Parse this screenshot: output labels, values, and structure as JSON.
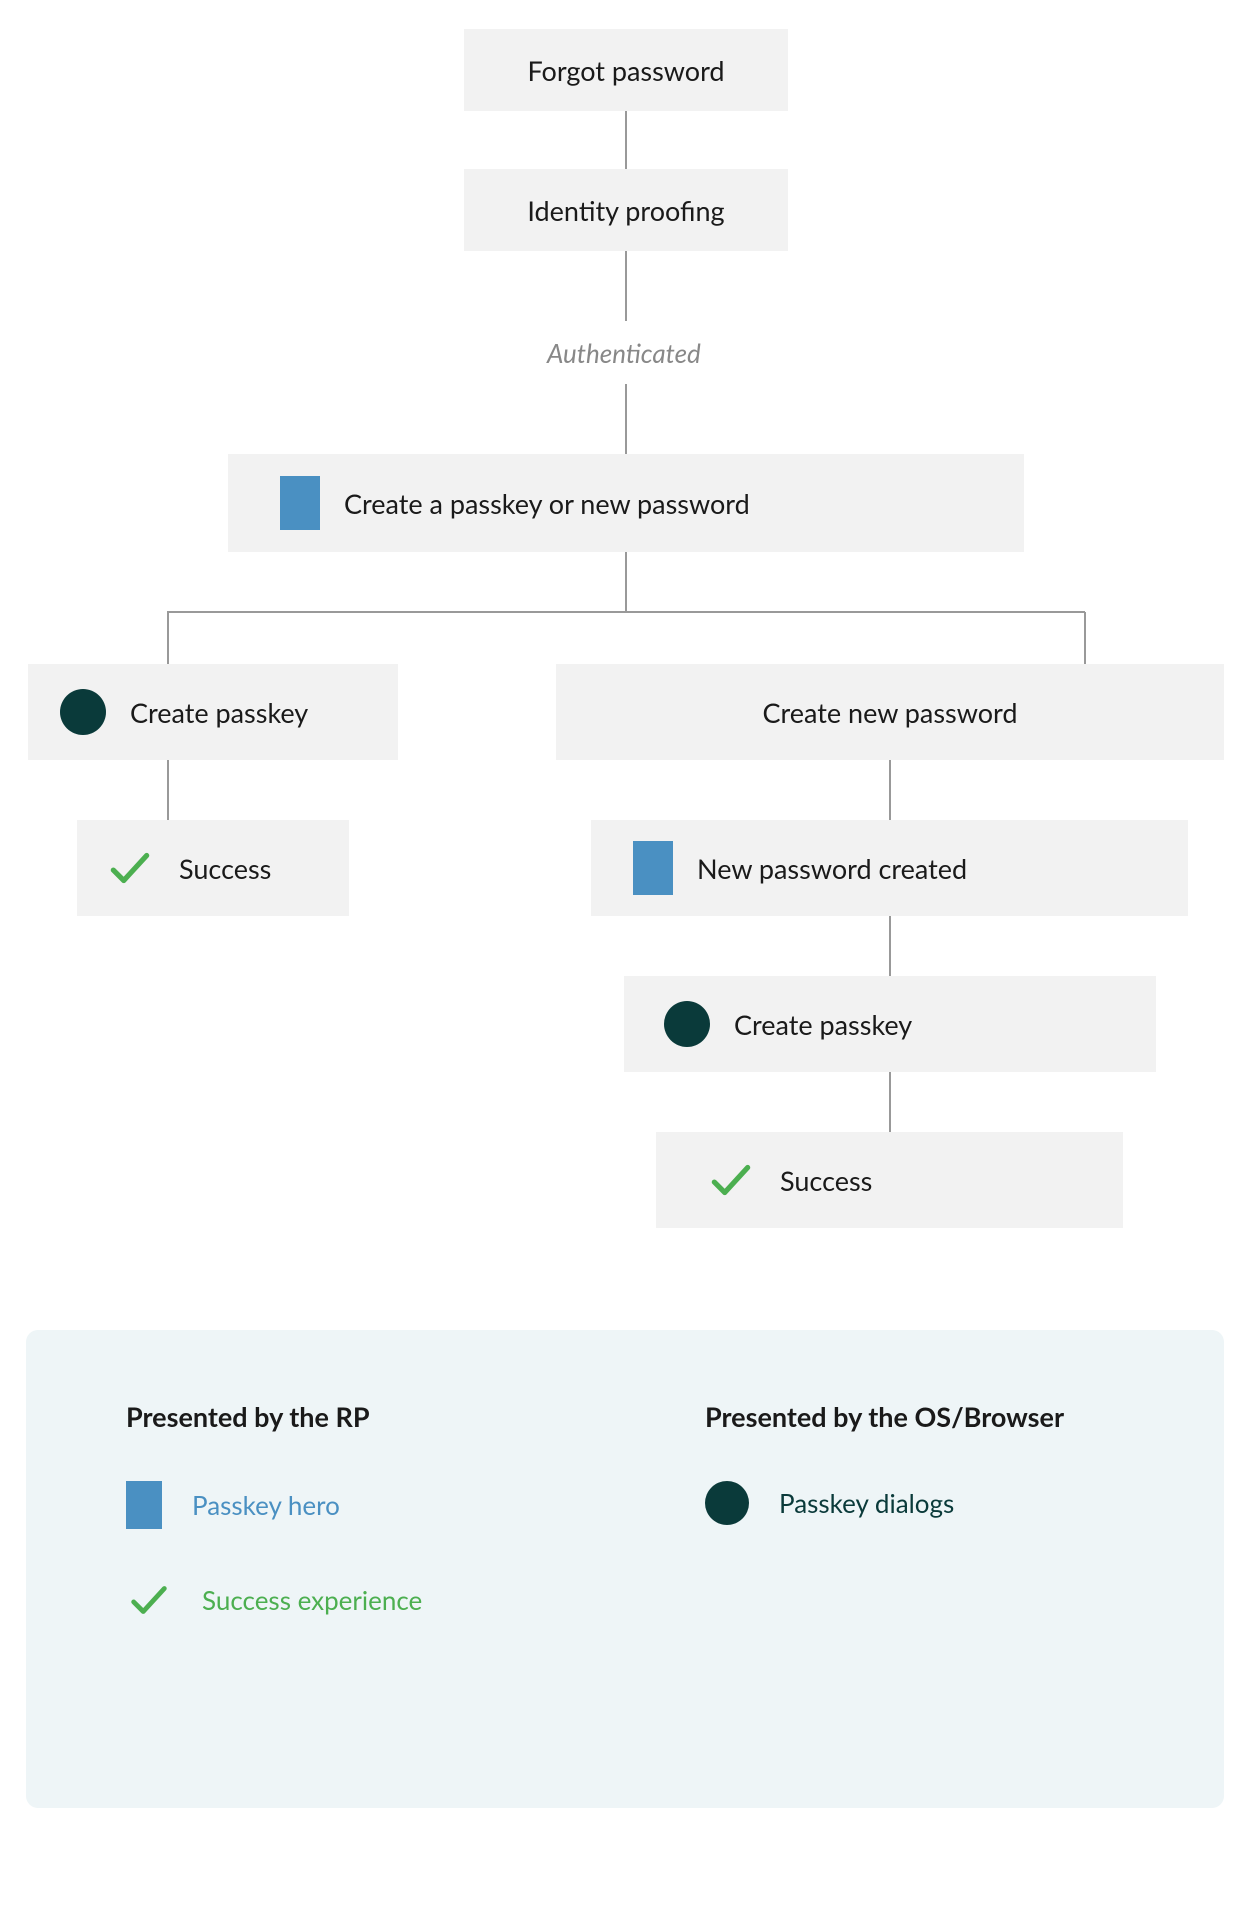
{
  "nodes": {
    "forgot_password": "Forgot password",
    "identity_proofing": "Identity proofing",
    "create_passkey_or_password": "Create a passkey or new password",
    "create_passkey": "Create passkey",
    "create_new_password": "Create new password",
    "success_left": "Success",
    "new_password_created": "New password created",
    "create_passkey_right": "Create passkey",
    "success_right": "Success"
  },
  "state": {
    "authenticated": "Authenticated"
  },
  "legend": {
    "rp_title": "Presented by the RP",
    "os_title": "Presented by the OS/Browser",
    "passkey_hero": "Passkey hero",
    "success_experience": "Success experience",
    "passkey_dialogs": "Passkey dialogs"
  },
  "colors": {
    "node_bg": "#f2f2f2",
    "hero_blue": "#4a90c2",
    "dialog_teal": "#0a3a3a",
    "success_green": "#4caf50",
    "legend_bg": "#eef5f7",
    "connector": "#999999"
  }
}
